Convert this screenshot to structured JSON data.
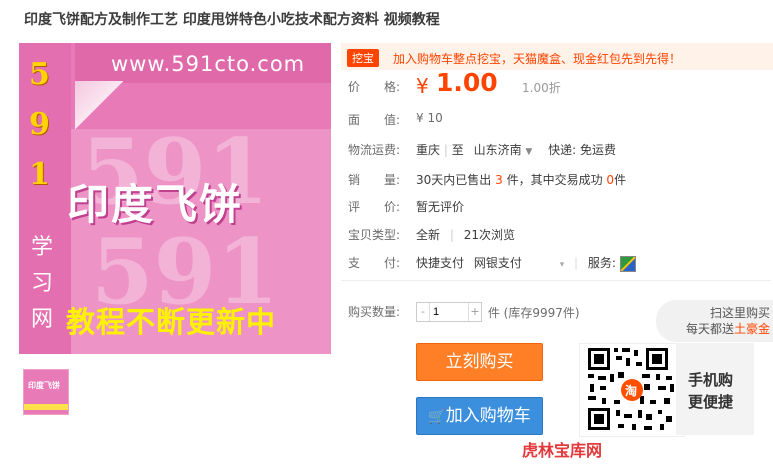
{
  "title": "印度飞饼配方及制作工艺 印度甩饼特色小吃技术配方资料 视频教程",
  "image": {
    "url_text": "www.591cto.com",
    "brand_digits": [
      "5",
      "9",
      "1"
    ],
    "brand_chars": [
      "学",
      "习",
      "网"
    ],
    "calligraphy": "印度飞饼",
    "tagline": "教程不断更新中",
    "thumb_text": "印度飞饼"
  },
  "promo": {
    "badge": "挖宝",
    "text": "加入购物车整点挖宝，天猫魔盒、现金红包先到先得！"
  },
  "price": {
    "label": "价　　格:",
    "symbol": "¥",
    "value": "1.00",
    "discount": "1.00折"
  },
  "face_value": {
    "label": "面　　值:",
    "value": "¥ 10"
  },
  "shipping": {
    "label": "物流运费:",
    "from": "重庆",
    "sep": "至",
    "to": "山东济南",
    "express": "快递: 免运费"
  },
  "sales": {
    "label": "销　　量:",
    "prefix": "30天内已售出",
    "count": "3",
    "mid": "件，其中交易成功",
    "success": "0",
    "suffix": "件"
  },
  "review": {
    "label": "评　　价:",
    "value": "暂无评价"
  },
  "item_type": {
    "label": "宝贝类型:",
    "condition": "全新",
    "views": "21次浏览"
  },
  "payment": {
    "label": "支　　付:",
    "quick": "快捷支付",
    "bank": "网银支付",
    "service_label": "服务:"
  },
  "quantity": {
    "label": "购买数量:",
    "minus": "-",
    "value": "1",
    "plus": "+",
    "stock": "件 (库存9997件)"
  },
  "buttons": {
    "buy_now": "立刻购买",
    "add_cart": "加入购物车"
  },
  "mobile": {
    "bubble_line1": "扫这里购买",
    "bubble_line2_prefix": "每天都送",
    "bubble_line2_gold": "土豪金",
    "label_line1": "手机购",
    "label_line2": "更便捷",
    "qr_badge": "淘"
  },
  "below_text": "虎林宝库网",
  "colors": {
    "accent": "#ff4400",
    "buy": "#ff7f27",
    "cart": "#3b8fdd",
    "image_bg": "#e87ab8"
  }
}
